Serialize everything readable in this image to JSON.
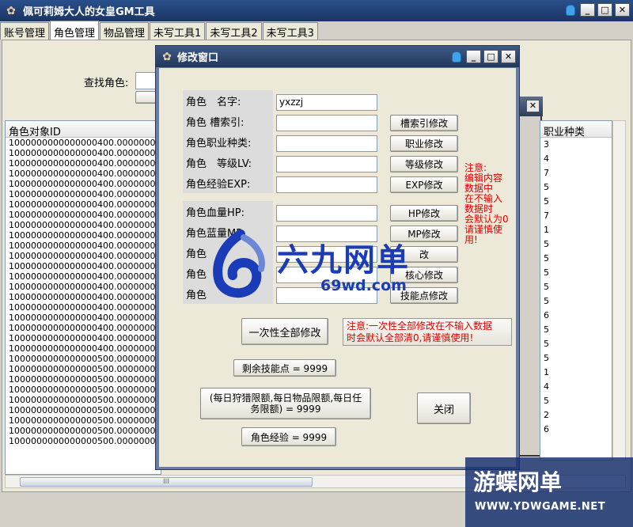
{
  "window": {
    "title": "佩可莉姆大人的女皇GM工具"
  },
  "tabs": [
    {
      "label": "账号管理"
    },
    {
      "label": "角色管理"
    },
    {
      "label": "物品管理"
    },
    {
      "label": "未写工具1"
    },
    {
      "label": "未写工具2"
    },
    {
      "label": "未写工具3"
    }
  ],
  "search": {
    "label": "查找角色:"
  },
  "list": {
    "header": "角色对象ID",
    "rows": [
      "1000000000000000400.00000000",
      "1000000000000000400.00000000",
      "1000000000000000400.00000000",
      "1000000000000000400.00000000",
      "1000000000000000400.00000000",
      "1000000000000000400.00000000",
      "1000000000000000400.00000000",
      "1000000000000000400.00000000",
      "1000000000000000400.00000000",
      "1000000000000000400.00000000",
      "1000000000000000400.00000000",
      "1000000000000000400.00000000",
      "1000000000000000400.00000000",
      "1000000000000000400.00000000",
      "1000000000000000400.00000000",
      "1000000000000000400.00000000",
      "1000000000000000400.00000000",
      "1000000000000000400.00000000",
      "1000000000000000400.00000000",
      "1000000000000000400.00000000",
      "1000000000000000400.00000000",
      "1000000000000000500.00000000",
      "1000000000000000500.00000000",
      "1000000000000000500.00000000",
      "1000000000000000500.00000000",
      "1000000000000000500.00000000",
      "1000000000000000500.00000000",
      "1000000000000000500.00000000",
      "1000000000000000500.00000000",
      "1000000000000000500.00000000"
    ]
  },
  "class_column": {
    "header": "职业种类",
    "rows": [
      "3",
      "4",
      "7",
      "5",
      "5",
      "7",
      "1",
      "5",
      "5",
      "5",
      "5",
      "5",
      "6",
      "5",
      "5",
      "5",
      "1",
      "4",
      "5",
      "2",
      "6"
    ]
  },
  "dialog": {
    "title": "修改窗口",
    "fields": {
      "name_label": "角色　名字:",
      "name_value": "yxzzj",
      "index_label": "角色 槽索引:",
      "job_label": "角色职业种类:",
      "level_label": "角色　等级LV:",
      "exp_label": "角色经验EXP:",
      "hp_label": "角色血量HP:",
      "mp_label": "角色蓝量MP:",
      "r8_label": "角色",
      "r9_label": "角色",
      "r10_label": "角色"
    },
    "buttons": {
      "index": "槽索引修改",
      "job": "职业修改",
      "level": "等级修改",
      "exp": "EXP修改",
      "hp": "HP修改",
      "mp": "MP修改",
      "b7": "改",
      "core": "核心修改",
      "skill": "技能点修改",
      "all": "一次性全部修改",
      "skill_points": "剩余技能点 = 9999",
      "daily": "(每日狩猎限额,每日物品限额,每日任务限额) = 9999",
      "char_exp": "角色经验 = 9999",
      "close": "关闭"
    },
    "note_side": [
      "注意:",
      "编辑内容",
      "数据中",
      "在不输入",
      "数据时",
      "会默认为0",
      "请谨慎使",
      "用!"
    ],
    "note_all": [
      "注意:一次性全部修改在不输入数据",
      "时会默认全部清0,请谨慎使用!"
    ]
  },
  "watermarks": {
    "logo_main": "六九网单",
    "logo_sub": "69wd.com",
    "logo2_main": "游蝶网单",
    "logo2_sub": "WWW.YDWGAME.NET"
  },
  "scroll": {
    "thumb_grip": "III"
  },
  "icons": {
    "app": "gear-app-icon",
    "pin": "pin-icon",
    "minimize": "minimize-icon",
    "maximize": "maximize-icon",
    "close": "close-icon"
  },
  "colors": {
    "titlebar": "#1b3563",
    "note_red": "#e00000",
    "watermark_blue": "#1a3cb8"
  }
}
